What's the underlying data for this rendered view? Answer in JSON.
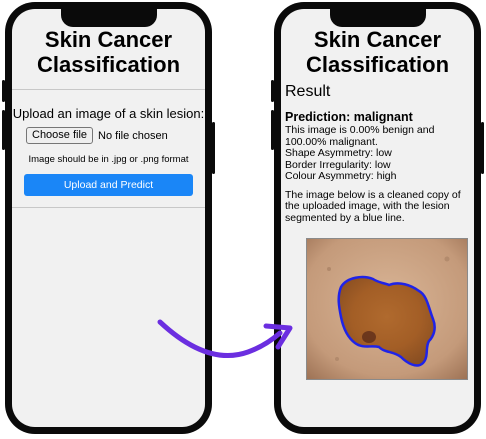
{
  "left_phone": {
    "title": "Skin Cancer\nClassification",
    "upload_prompt": "Upload an image of a skin lesion:",
    "choose_file_label": "Choose file",
    "file_status": "No file chosen",
    "format_note": "Image should be in .jpg or .png format",
    "submit_label": "Upload and Predict"
  },
  "right_phone": {
    "title": "Skin Cancer\nClassification",
    "result_heading": "Result",
    "prediction": "Prediction: malignant",
    "summary": "This image is 0.00% benign and 100.00% malignant.",
    "stats": {
      "shape": "Shape Asymmetry: low",
      "border": "Border Irregularity: low",
      "colour": "Colour Asymmetry: high"
    },
    "cleaned_note": "The image below is a cleaned copy of the uploaded image, with the lesion segmented by a blue line."
  },
  "colors": {
    "primary_button": "#1a86f7",
    "segmentation_line": "#1f23e8",
    "arrow": "#6b2ee0"
  }
}
